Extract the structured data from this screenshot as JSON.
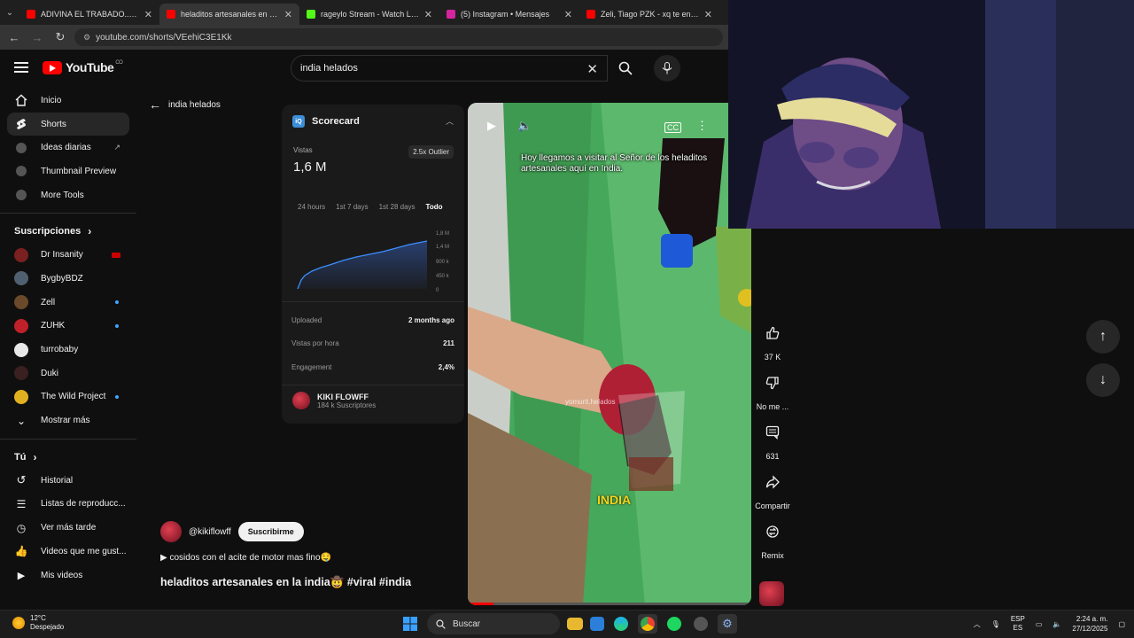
{
  "browser": {
    "tabs": [
      {
        "title": "ADIVINA EL TRABADO... - YouTube",
        "color": "#ff0000",
        "active": false
      },
      {
        "title": "heladitos artesanales en la india",
        "color": "#ff0000",
        "active": true
      },
      {
        "title": "rageylo Stream - Watch Live on",
        "color": "#53fc18",
        "active": false
      },
      {
        "title": "(5) Instagram • Mensajes",
        "color": "#d6249f",
        "active": false
      },
      {
        "title": "Zeli, Tiago PZK - xq te enamora",
        "color": "#ff0000",
        "active": false
      }
    ],
    "url": "youtube.com/shorts/VEehiC3E1Kk"
  },
  "header": {
    "logo_text": "YouTube",
    "region": "CO",
    "search_value": "india helados"
  },
  "sidebar": {
    "main": [
      {
        "label": "Inicio",
        "icon": "home-icon",
        "active": false
      },
      {
        "label": "Shorts",
        "icon": "shorts-icon",
        "active": true
      },
      {
        "label": "Ideas diarias",
        "icon": "extension-icon",
        "active": false,
        "ext": true
      },
      {
        "label": "Thumbnail Preview",
        "icon": "extension-icon",
        "active": false
      },
      {
        "label": "More Tools",
        "icon": "extension-icon",
        "active": false
      }
    ],
    "subs_title": "Suscripciones",
    "subs": [
      {
        "label": "Dr Insanity",
        "color": "#7a2020",
        "badge": "live"
      },
      {
        "label": "BygbyBDZ",
        "color": "#506070",
        "badge": ""
      },
      {
        "label": "Zell",
        "color": "#6a4a2a",
        "badge": "dot"
      },
      {
        "label": "ZUHK",
        "color": "#c0202a",
        "badge": "dot"
      },
      {
        "label": "turrobaby",
        "color": "#e8e8e8",
        "badge": ""
      },
      {
        "label": "Duki",
        "color": "#3a2020",
        "badge": ""
      },
      {
        "label": "The Wild Project",
        "color": "#e0b020",
        "badge": "dot"
      }
    ],
    "show_more": "Mostrar más",
    "you_title": "Tú",
    "you": [
      {
        "label": "Historial",
        "icon": "history-icon"
      },
      {
        "label": "Listas de reproducc...",
        "icon": "playlists-icon"
      },
      {
        "label": "Ver más tarde",
        "icon": "watch-later-icon"
      },
      {
        "label": "Videos que me gust...",
        "icon": "like-icon"
      },
      {
        "label": "Mis videos",
        "icon": "my-videos-icon"
      }
    ]
  },
  "back_label": "india helados",
  "scorecard": {
    "title": "Scorecard",
    "views_label": "Vistas",
    "views_value": "1,6 M",
    "outlier": "2.5x Outlier",
    "tabs": [
      "24 hours",
      "1st 7 days",
      "1st 28 days",
      "Todo"
    ],
    "active_tab": "Todo",
    "y_ticks": [
      "1,8 M",
      "1,4 M",
      "900 k",
      "450 k",
      "0"
    ],
    "uploaded_label": "Uploaded",
    "uploaded_value": "2 months ago",
    "vph_label": "Vistas por hora",
    "vph_value": "211",
    "eng_label": "Engagement",
    "eng_value": "2,4%",
    "channel_name": "KIKI FLOWFF",
    "channel_subs": "184 k Suscriptores"
  },
  "video": {
    "caption": "Hoy llegamos a visitar al Señor de los heladitos artesanales aquí en India.",
    "overlay_text": "INDIA",
    "watermark": "yomurit.helados"
  },
  "actions": [
    {
      "label": "37 K",
      "icon": "like-icon"
    },
    {
      "label": "No me ...",
      "icon": "dislike-icon"
    },
    {
      "label": "631",
      "icon": "comment-icon"
    },
    {
      "label": "Compartir",
      "icon": "share-icon"
    },
    {
      "label": "Remix",
      "icon": "remix-icon"
    }
  ],
  "channel": {
    "handle": "@kikiflowff",
    "subscribe": "Suscribirme"
  },
  "description": "▶ cosidos con el acite de motor mas fino🤤",
  "title": "heladitos artesanales en la india🤠 #viral #india",
  "taskbar": {
    "temp": "12°C",
    "weather": "Despejado",
    "search": "Buscar",
    "lang1": "ESP",
    "lang2": "ES",
    "time": "2:24 a. m.",
    "date": "27/12/2025"
  }
}
